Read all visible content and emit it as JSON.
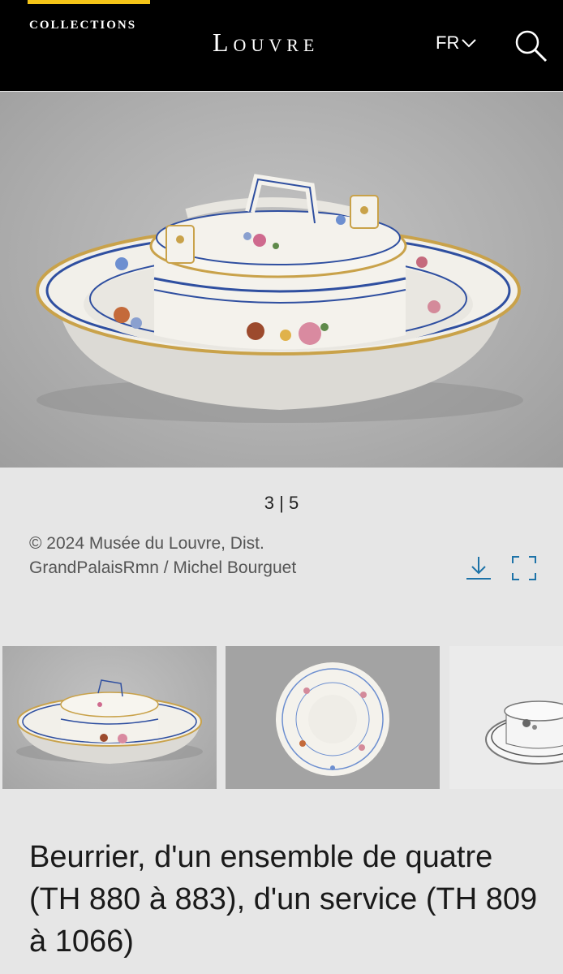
{
  "header": {
    "collections_label": "COLLECTIONS",
    "logo_text": "Louvre",
    "language": "FR"
  },
  "gallery": {
    "counter": "3 | 5",
    "credit": "© 2024 Musée du Louvre, Dist. GrandPalaisRmn / Michel Bourguet"
  },
  "artwork": {
    "title": "Beurrier, d'un ensemble de quatre (TH 880 à 883), d'un service (TH 809 à 1066)"
  },
  "colors": {
    "header_bg": "#000000",
    "accent": "#f5c518",
    "icon_blue": "#1e73a8",
    "page_bg": "#e6e6e6"
  },
  "icons": [
    "chevron-down-icon",
    "search-icon",
    "download-icon",
    "fullscreen-icon"
  ]
}
